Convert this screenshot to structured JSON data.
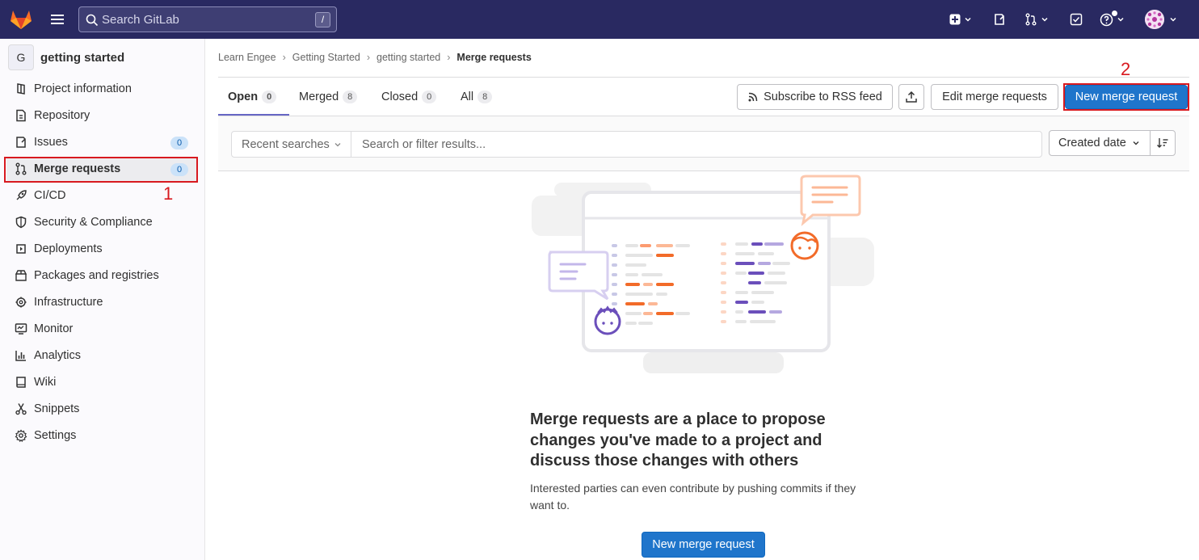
{
  "topbar": {
    "search_placeholder": "Search GitLab",
    "search_shortcut": "/"
  },
  "sidebar": {
    "project_initial": "G",
    "project_name": "getting started",
    "items": [
      {
        "label": "Project information"
      },
      {
        "label": "Repository"
      },
      {
        "label": "Issues",
        "badge": "0"
      },
      {
        "label": "Merge requests",
        "badge": "0"
      },
      {
        "label": "CI/CD"
      },
      {
        "label": "Security & Compliance"
      },
      {
        "label": "Deployments"
      },
      {
        "label": "Packages and registries"
      },
      {
        "label": "Infrastructure"
      },
      {
        "label": "Monitor"
      },
      {
        "label": "Analytics"
      },
      {
        "label": "Wiki"
      },
      {
        "label": "Snippets"
      },
      {
        "label": "Settings"
      }
    ]
  },
  "annotations": {
    "one": "1",
    "two": "2"
  },
  "breadcrumb": [
    "Learn Engee",
    "Getting Started",
    "getting started",
    "Merge requests"
  ],
  "tabs": [
    {
      "label": "Open",
      "count": "0"
    },
    {
      "label": "Merged",
      "count": "8"
    },
    {
      "label": "Closed",
      "count": "0"
    },
    {
      "label": "All",
      "count": "8"
    }
  ],
  "actions": {
    "rss": "Subscribe to RSS feed",
    "edit": "Edit merge requests",
    "new": "New merge request"
  },
  "filter": {
    "recent": "Recent searches",
    "placeholder": "Search or filter results...",
    "sort": "Created date"
  },
  "empty": {
    "title": "Merge requests are a place to propose changes you've made to a project and discuss those changes with others",
    "description": "Interested parties can even contribute by pushing commits if they want to.",
    "button": "New merge request"
  },
  "colors": {
    "navbar": "#292961",
    "primary": "#1f75cb",
    "highlight": "#d8191f"
  }
}
